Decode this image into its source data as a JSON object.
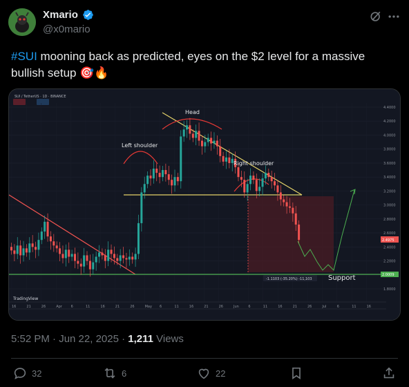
{
  "author": {
    "name": "Xmario",
    "handle": "@x0mario"
  },
  "tweet": {
    "hashtag": "#SUI",
    "text_line1": " mooning back as predicted, eyes on the $2 level for a massive",
    "text_line2": "bullish setup 🎯🔥"
  },
  "chart": {
    "symbol_label": "SUI / TetherUS · 1D · BINANCE",
    "annotations": {
      "head": "Head",
      "left_shoulder": "Left shoulder",
      "right_shoulder": "Right shoulder",
      "support": "Support",
      "measure": "-1.1103 (-35.20%) -11,103"
    },
    "price_axis": [
      "4.4000",
      "4.2000",
      "4.0000",
      "3.8000",
      "3.6000",
      "3.4000",
      "3.2000",
      "3.0000",
      "2.8000",
      "2.6000",
      "2.4000",
      "2.2000",
      "2.0000",
      "1.8000"
    ],
    "current_price": "2.4975",
    "support_price": "2.0009",
    "date_axis": [
      "16",
      "21",
      "26",
      "Apr",
      "6",
      "11",
      "16",
      "21",
      "26",
      "May",
      "6",
      "11",
      "16",
      "21",
      "26",
      "Jun",
      "6",
      "11",
      "16",
      "21",
      "26",
      "Jul",
      "6",
      "11",
      "16"
    ],
    "watermark": "TradingView",
    "colors": {
      "background": "#131722",
      "up": "#26a69a",
      "down": "#ef5350",
      "neckline": "#e6d36a",
      "support": "#4caf50",
      "downtrend": "#ef5350",
      "arcs": "#e53935"
    }
  },
  "meta": {
    "time": "5:52 PM · Jun 22, 2025 · ",
    "views_count": "1,211",
    "views_label": " Views"
  },
  "actions": {
    "replies": "32",
    "reposts": "6",
    "likes": "22"
  }
}
